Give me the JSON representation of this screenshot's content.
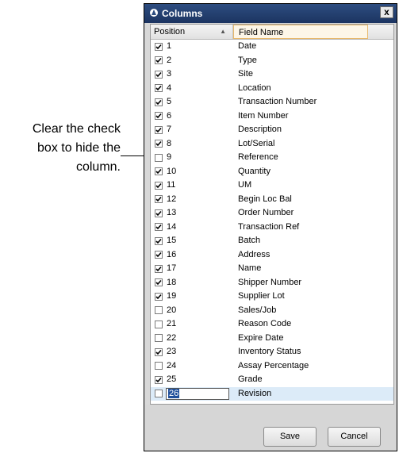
{
  "callout": {
    "lines": [
      "Clear the check",
      "box to hide the",
      "column."
    ]
  },
  "window": {
    "title": "Columns",
    "close_label": "x"
  },
  "grid": {
    "headers": {
      "position": "Position",
      "field_name": "Field Name"
    },
    "rows": [
      {
        "position": "1",
        "field": "Date",
        "checked": true
      },
      {
        "position": "2",
        "field": "Type",
        "checked": true
      },
      {
        "position": "3",
        "field": "Site",
        "checked": true
      },
      {
        "position": "4",
        "field": "Location",
        "checked": true
      },
      {
        "position": "5",
        "field": "Transaction Number",
        "checked": true
      },
      {
        "position": "6",
        "field": "Item Number",
        "checked": true
      },
      {
        "position": "7",
        "field": "Description",
        "checked": true
      },
      {
        "position": "8",
        "field": "Lot/Serial",
        "checked": true
      },
      {
        "position": "9",
        "field": "Reference",
        "checked": false
      },
      {
        "position": "10",
        "field": "Quantity",
        "checked": true
      },
      {
        "position": "11",
        "field": "UM",
        "checked": true
      },
      {
        "position": "12",
        "field": "Begin Loc Bal",
        "checked": true
      },
      {
        "position": "13",
        "field": "Order Number",
        "checked": true
      },
      {
        "position": "14",
        "field": "Transaction Ref",
        "checked": true
      },
      {
        "position": "15",
        "field": "Batch",
        "checked": true
      },
      {
        "position": "16",
        "field": "Address",
        "checked": true
      },
      {
        "position": "17",
        "field": "Name",
        "checked": true
      },
      {
        "position": "18",
        "field": "Shipper Number",
        "checked": true
      },
      {
        "position": "19",
        "field": "Supplier Lot",
        "checked": true
      },
      {
        "position": "20",
        "field": "Sales/Job",
        "checked": false
      },
      {
        "position": "21",
        "field": "Reason Code",
        "checked": false
      },
      {
        "position": "22",
        "field": "Expire Date",
        "checked": false
      },
      {
        "position": "23",
        "field": "Inventory Status",
        "checked": true
      },
      {
        "position": "24",
        "field": "Assay Percentage",
        "checked": false
      },
      {
        "position": "25",
        "field": "Grade",
        "checked": true
      },
      {
        "position": "26",
        "field": "Revision",
        "checked": false,
        "editing": true
      }
    ]
  },
  "buttons": {
    "save": "Save",
    "cancel": "Cancel"
  }
}
